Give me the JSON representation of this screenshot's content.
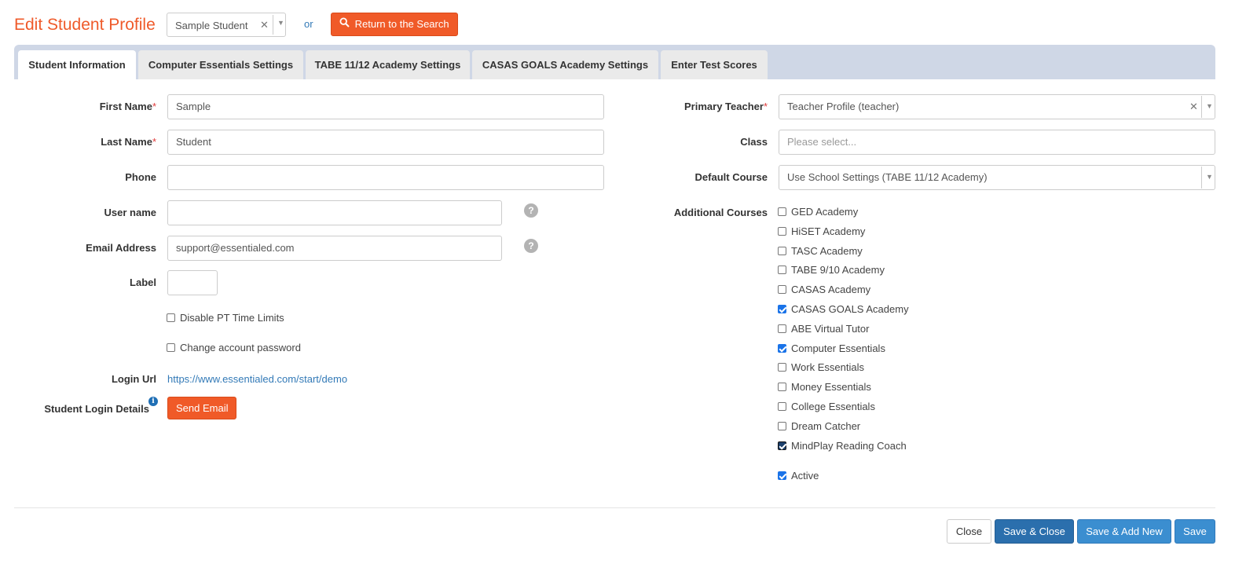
{
  "header": {
    "title": "Edit Student Profile",
    "student_select_value": "Sample Student",
    "or_text": "or",
    "return_button": "Return to the Search"
  },
  "tabs": [
    {
      "label": "Student Information",
      "active": true
    },
    {
      "label": "Computer Essentials Settings",
      "active": false
    },
    {
      "label": "TABE 11/12 Academy Settings",
      "active": false
    },
    {
      "label": "CASAS GOALS Academy Settings",
      "active": false
    },
    {
      "label": "Enter Test Scores",
      "active": false
    }
  ],
  "left_form": {
    "first_name": {
      "label": "First Name",
      "value": "Sample",
      "required_mark": "*"
    },
    "last_name": {
      "label": "Last Name",
      "value": "Student",
      "required_mark": "*"
    },
    "phone": {
      "label": "Phone",
      "value": ""
    },
    "username": {
      "label": "User name",
      "value": ""
    },
    "email": {
      "label": "Email Address",
      "value": "support@essentialed.com"
    },
    "label_field": {
      "label": "Label",
      "value": ""
    },
    "disable_pt": {
      "label": "Disable PT Time Limits",
      "checked": false
    },
    "change_password": {
      "label": "Change account password",
      "checked": false
    },
    "login_url": {
      "label": "Login Url",
      "value": "https://www.essentialed.com/start/demo"
    },
    "login_details": {
      "label": "Student Login Details",
      "button": "Send Email"
    }
  },
  "right_form": {
    "primary_teacher": {
      "label": "Primary Teacher",
      "value": "Teacher Profile (teacher)",
      "required_mark": "*"
    },
    "class": {
      "label": "Class",
      "placeholder": "Please select..."
    },
    "default_course": {
      "label": "Default Course",
      "value": "Use School Settings (TABE 11/12 Academy)"
    },
    "additional_courses_label": "Additional Courses",
    "courses": [
      {
        "label": "GED Academy",
        "checked": false
      },
      {
        "label": "HiSET Academy",
        "checked": false
      },
      {
        "label": "TASC Academy",
        "checked": false
      },
      {
        "label": "TABE 9/10 Academy",
        "checked": false
      },
      {
        "label": "CASAS Academy",
        "checked": false
      },
      {
        "label": "CASAS GOALS Academy",
        "checked": true
      },
      {
        "label": "ABE Virtual Tutor",
        "checked": false
      },
      {
        "label": "Computer Essentials",
        "checked": true
      },
      {
        "label": "Work Essentials",
        "checked": false
      },
      {
        "label": "Money Essentials",
        "checked": false
      },
      {
        "label": "College Essentials",
        "checked": false
      },
      {
        "label": "Dream Catcher",
        "checked": false
      },
      {
        "label": "MindPlay Reading Coach",
        "checked": true
      }
    ],
    "active": {
      "label": "Active",
      "checked": true
    }
  },
  "footer": {
    "close": "Close",
    "save_close": "Save & Close",
    "save_add_new": "Save & Add New",
    "save": "Save"
  },
  "colors": {
    "brand_orange": "#f05a28",
    "tab_bar": "#cfd7e6",
    "primary_blue": "#2b6fad",
    "link_blue": "#337ab7"
  },
  "icons": {
    "help": "question-circle",
    "info": "info-circle",
    "search": "magnifier"
  }
}
